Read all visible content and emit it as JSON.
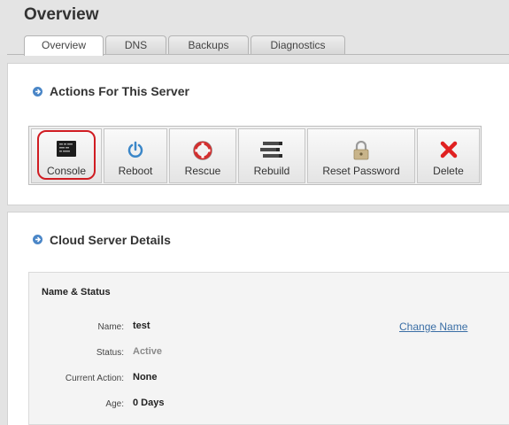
{
  "page": {
    "title": "Overview"
  },
  "tabs": [
    {
      "label": "Overview",
      "active": true
    },
    {
      "label": "DNS",
      "active": false
    },
    {
      "label": "Backups",
      "active": false
    },
    {
      "label": "Diagnostics",
      "active": false
    }
  ],
  "actions": {
    "title": "Actions For This Server",
    "buttons": [
      {
        "label": "Console",
        "icon": "console-icon",
        "highlighted": true
      },
      {
        "label": "Reboot",
        "icon": "power-icon"
      },
      {
        "label": "Rescue",
        "icon": "lifebuoy-icon"
      },
      {
        "label": "Rebuild",
        "icon": "server-stack-icon"
      },
      {
        "label": "Reset Password",
        "icon": "padlock-icon"
      },
      {
        "label": "Delete",
        "icon": "red-x-icon"
      }
    ]
  },
  "details": {
    "title": "Cloud Server Details",
    "subsection": "Name & Status",
    "fields": [
      {
        "label": "Name:",
        "value": "test"
      },
      {
        "label": "Status:",
        "value": "Active"
      },
      {
        "label": "Current Action:",
        "value": "None"
      },
      {
        "label": "Age:",
        "value": "0 Days"
      }
    ],
    "change_name_link": "Change Name"
  },
  "colors": {
    "accent_blue": "#4a86c7",
    "highlight_red": "#d01c22",
    "link_blue": "#3a6ea5",
    "status_gray": "#8a8a8a"
  }
}
